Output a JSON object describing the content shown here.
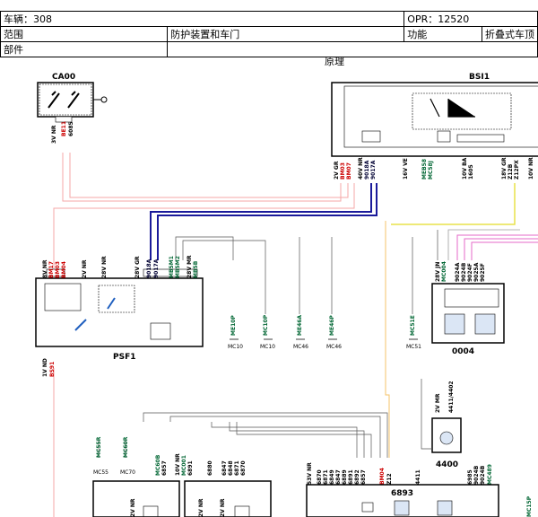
{
  "header": {
    "vehicle": "车辆：308",
    "opr": "OPR：12520",
    "scope_label": "范围",
    "scope_value": "防护装置和车门",
    "function_label": "功能",
    "function_value": "折叠式车顶",
    "part_label": "部件"
  },
  "diagram_title": "原理",
  "components": {
    "ca00": "CA00",
    "bsi1": "BSI1",
    "psf1": "PSF1",
    "c0004": "0004",
    "c4400": "4400",
    "c6893": "6893"
  },
  "connectors": {
    "ca00": "3V NR",
    "bsi_a": "2V GR",
    "bsi_b": "40V NR",
    "bsi_c": "16V VE",
    "bsi_d": "10V BA",
    "bsi_e": "18V GR",
    "bsi_f": "10V NR",
    "psf_a": "8V NR",
    "psf_b": "2V NR",
    "psf_c": "28V NR",
    "psf_d": "28V GR",
    "psf_e": "28V MR",
    "psf_f": "1V ND",
    "c0004": "28V JN",
    "c4400": "2V MR",
    "c6893": "53V NR",
    "b1": "2V NR",
    "b2": "10V NR",
    "b3": "2V NR",
    "b4": "2V NR"
  },
  "wires": {
    "ca00_1": "BE11",
    "ca00_2": "6085",
    "bsi_1": "BM03",
    "bsi_2": "BM07",
    "bsi_3": "9018A",
    "bsi_4": "9017A",
    "bsi_5": "MEB58",
    "bsi_6": "MC58J",
    "bsi_7": "1605",
    "bsi_8": "Z12B",
    "bsi_9": "Z12PX",
    "psf_1": "BM17",
    "psf_2": "BM03",
    "psf_3": "BM04",
    "psf_4": "9018A",
    "psf_5": "9017A",
    "psf_6": "MB5M1",
    "psf_7": "MB5M2",
    "psf_8": "MB5B",
    "psf_gnd": "BS91",
    "m1": "ME10P",
    "m2": "MC10P",
    "m3": "ME46A",
    "m4": "ME46P",
    "m5": "MC51E",
    "c0004_1": "MC004",
    "c0004_2": "9024A",
    "c0004_3": "9024B",
    "c0004_4": "9024F",
    "c0004_5": "9025A",
    "c0004_6": "9025F",
    "c4400_1": "4411/4402",
    "lower_1": "MC55R",
    "lower_2": "MC60R",
    "lower_3": "MC60B",
    "lower_4": "6857",
    "lower_5": "MC001",
    "lower_6": "6891",
    "lower_7": "6880",
    "lower_8": "6847",
    "lower_9": "6848",
    "lower_10": "6871",
    "lower_11": "6870",
    "l6893_1": "6870",
    "l6893_2": "6871",
    "l6893_3": "6849",
    "l6893_4": "6847",
    "l6893_5": "6889",
    "l6893_6": "6891",
    "l6893_7": "6892",
    "l6893_8": "6857",
    "l6893_9": "BM04",
    "l6893_10": "Z12",
    "l6893_11": "4411",
    "l6893_12": "6985",
    "l6893_13": "9024B",
    "l6893_14": "9024B",
    "l6893_15": "MC489",
    "l6893_16": "MC15P"
  },
  "grounds": {
    "g1": "MC10",
    "g2": "MC10",
    "g3": "MC46",
    "g4": "MC46",
    "g5": "MC51",
    "g6": "MC55",
    "g7": "MC70"
  }
}
